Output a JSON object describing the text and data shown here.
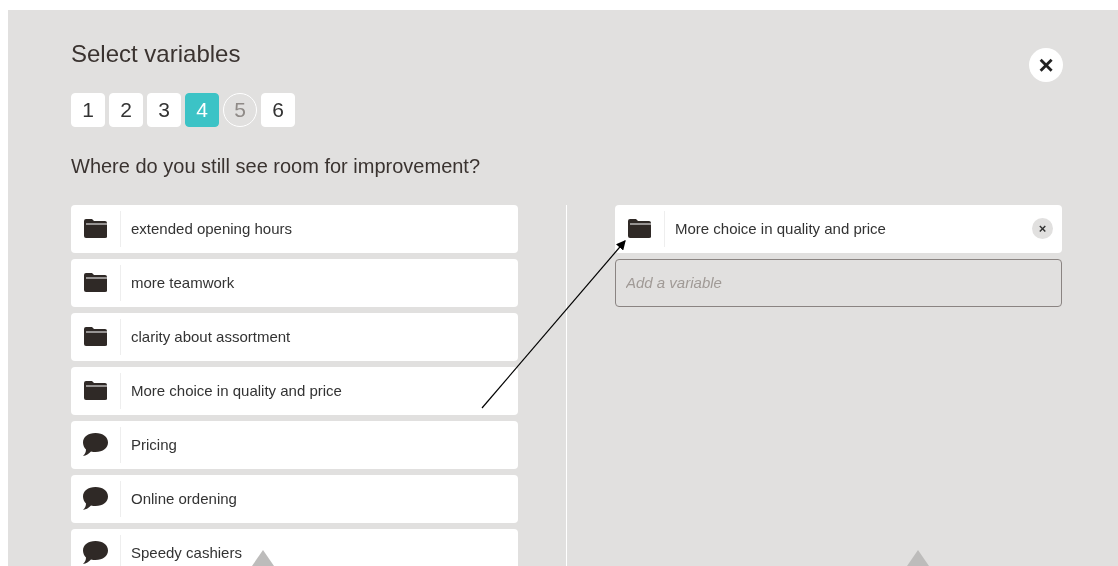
{
  "dialog": {
    "title": "Select variables",
    "close_label": "×"
  },
  "steps": [
    {
      "label": "1",
      "selected": false,
      "disabled": false
    },
    {
      "label": "2",
      "selected": false,
      "disabled": false
    },
    {
      "label": "3",
      "selected": false,
      "disabled": false
    },
    {
      "label": "4",
      "selected": true,
      "disabled": false
    },
    {
      "label": "5",
      "selected": false,
      "disabled": true
    },
    {
      "label": "6",
      "selected": false,
      "disabled": false
    }
  ],
  "question": "Where do you still see room for improvement?",
  "available": [
    {
      "kind": "folder",
      "label": "extended opening hours"
    },
    {
      "kind": "folder",
      "label": "more teamwork"
    },
    {
      "kind": "folder",
      "label": "clarity about assortment"
    },
    {
      "kind": "folder",
      "label": "More choice in quality and price"
    },
    {
      "kind": "comment",
      "label": "Pricing"
    },
    {
      "kind": "comment",
      "label": "Online ordening"
    },
    {
      "kind": "comment",
      "label": "Speedy cashiers"
    }
  ],
  "selected_variables": [
    {
      "kind": "folder",
      "label": "More choice in quality and price",
      "remove_label": "×"
    }
  ],
  "add_field": {
    "placeholder": "Add a variable"
  }
}
